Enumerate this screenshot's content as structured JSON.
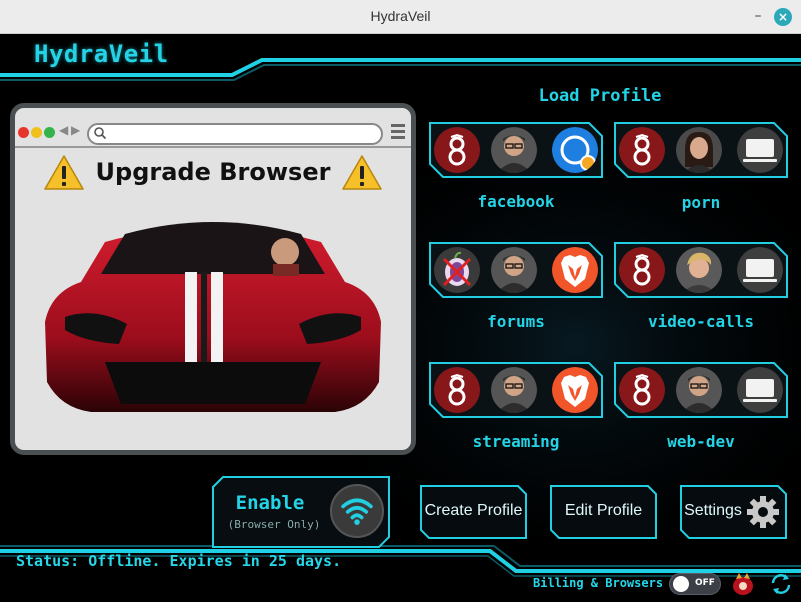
{
  "window": {
    "title": "HydraVeil",
    "minimize_label": "–",
    "close_label": "×"
  },
  "app": {
    "logo": "HydraVeil"
  },
  "upgrade_panel": {
    "heading": "Upgrade Browser"
  },
  "load_profile": {
    "title": "Load Profile",
    "profiles": [
      {
        "name": "facebook",
        "icons": [
          "wireguard-icon",
          "person-avatar",
          "browser-globe-icon"
        ]
      },
      {
        "name": "porn",
        "icons": [
          "wireguard-icon",
          "woman-avatar",
          "laptop-icon"
        ]
      },
      {
        "name": "forums",
        "icons": [
          "tor-disabled-icon",
          "person-avatar",
          "brave-icon"
        ]
      },
      {
        "name": "video-calls",
        "icons": [
          "wireguard-icon",
          "blond-man-avatar",
          "laptop-icon"
        ]
      },
      {
        "name": "streaming",
        "icons": [
          "wireguard-icon",
          "person-avatar",
          "brave-icon"
        ]
      },
      {
        "name": "web-dev",
        "icons": [
          "wireguard-icon",
          "person-avatar",
          "laptop-icon"
        ]
      }
    ]
  },
  "enable_button": {
    "label": "Enable",
    "sublabel": "(Browser Only)"
  },
  "actions": {
    "create": "Create Profile",
    "edit": "Edit Profile",
    "settings": "Settings"
  },
  "status": {
    "text": "Status: Offline. Expires in 25 days."
  },
  "footer": {
    "billing": "Billing & Browsers",
    "toggle_state": "OFF"
  },
  "colors": {
    "accent": "#24d4e6",
    "background": "#000000",
    "wireguard_red": "#88171a"
  }
}
